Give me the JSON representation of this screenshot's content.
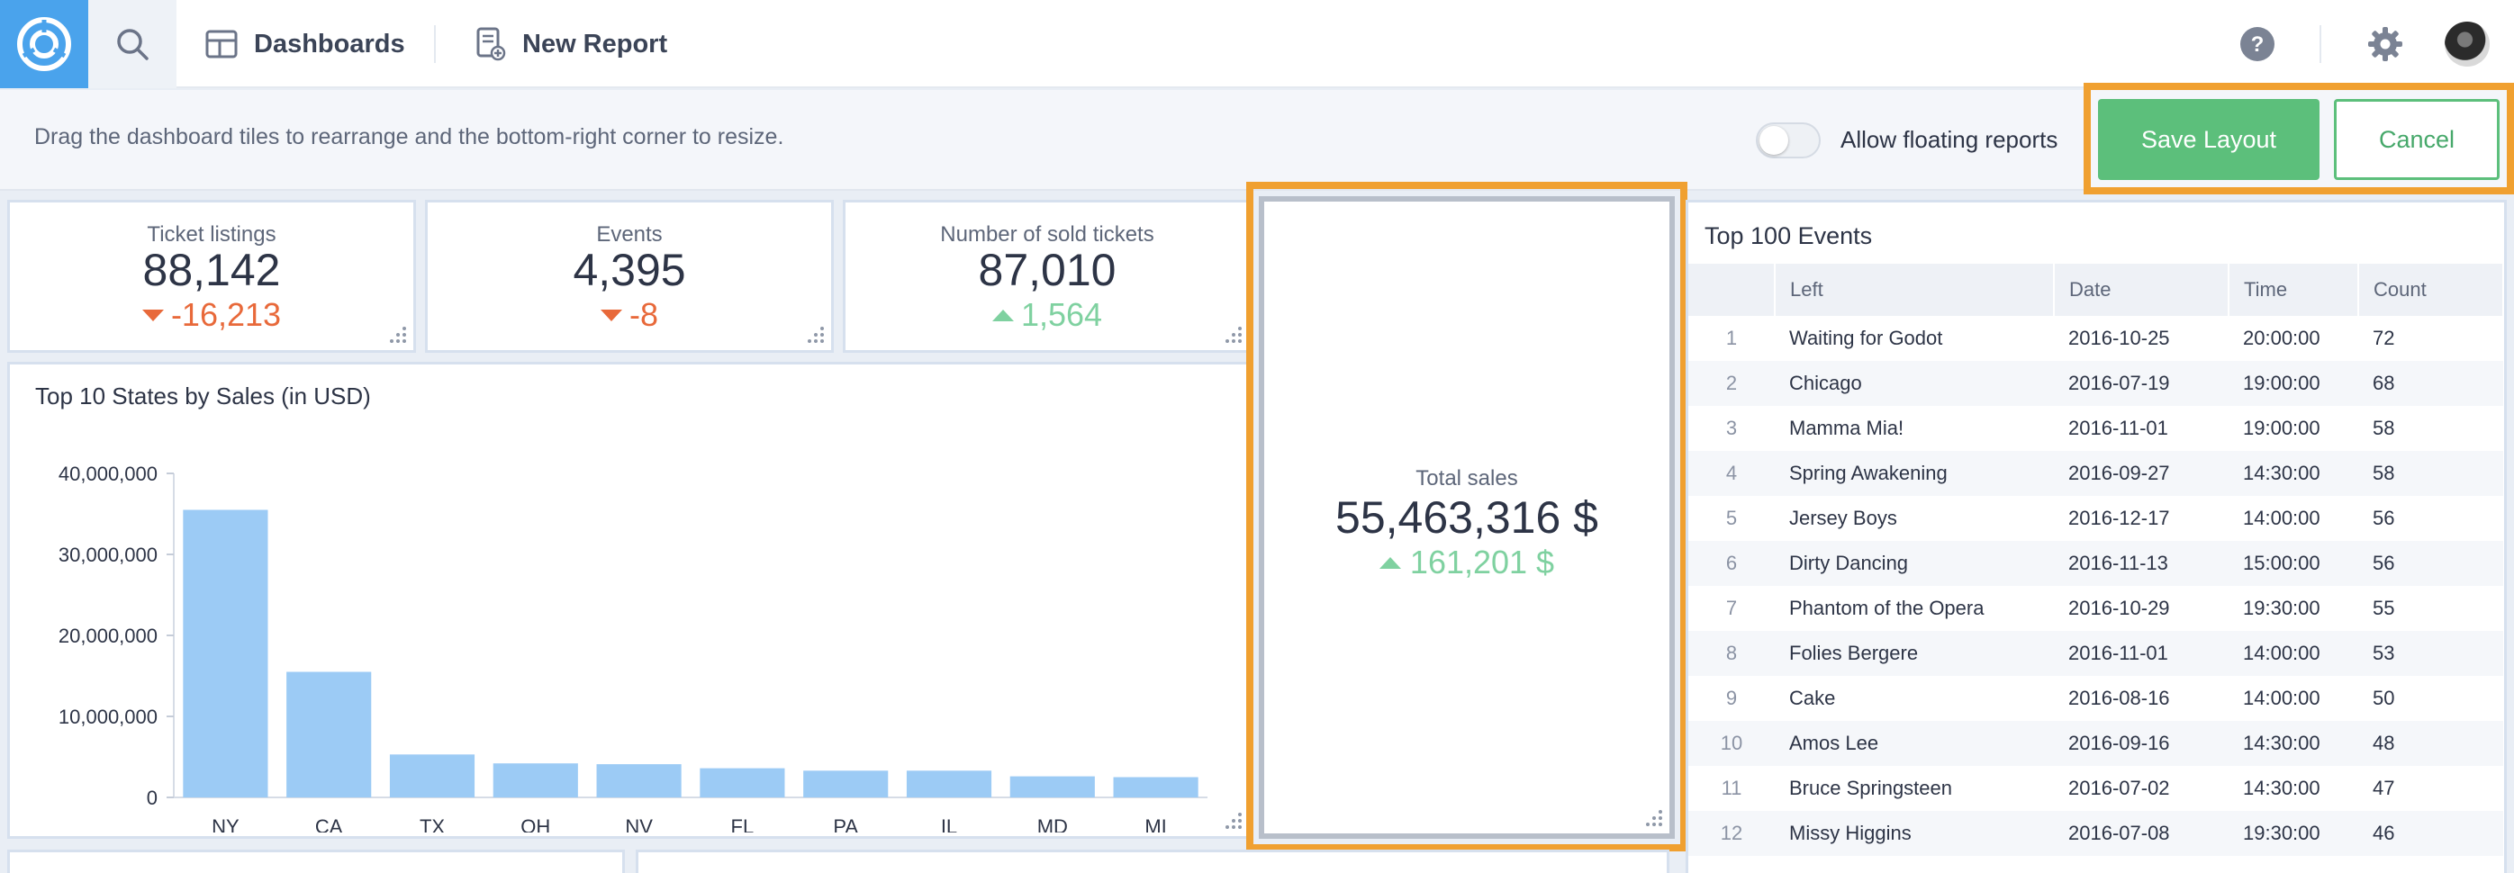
{
  "nav": {
    "dashboards_label": "Dashboards",
    "new_report_label": "New Report"
  },
  "editbar": {
    "hint": "Drag the dashboard tiles to rearrange and the bottom-right corner to resize.",
    "floating_label": "Allow floating reports",
    "floating_enabled": false,
    "save_label": "Save Layout",
    "cancel_label": "Cancel"
  },
  "kpis": [
    {
      "title": "Ticket listings",
      "value": "88,142",
      "delta": "-16,213",
      "direction": "down"
    },
    {
      "title": "Events",
      "value": "4,395",
      "delta": "-8",
      "direction": "down"
    },
    {
      "title": "Number of sold tickets",
      "value": "87,010",
      "delta": "1,564",
      "direction": "up"
    }
  ],
  "total_sales": {
    "title": "Total sales",
    "value": "55,463,316 $",
    "delta": "161,201 $",
    "direction": "up"
  },
  "chart_data": {
    "type": "bar",
    "title": "Top 10 States by Sales (in USD)",
    "categories": [
      "NY",
      "CA",
      "TX",
      "OH",
      "NV",
      "FL",
      "PA",
      "IL",
      "MD",
      "MI"
    ],
    "values": [
      35500000,
      15500000,
      5300000,
      4200000,
      4100000,
      3600000,
      3300000,
      3300000,
      2600000,
      2500000
    ],
    "yticks": [
      "0",
      "10,000,000",
      "20,000,000",
      "30,000,000",
      "40,000,000"
    ],
    "ylim": [
      0,
      40000000
    ],
    "color": "#9ccbf5"
  },
  "table": {
    "title": "Top 100 Events",
    "headers": [
      "",
      "Left",
      "Date",
      "Time",
      "Count"
    ],
    "rows": [
      [
        "1",
        "Waiting for Godot",
        "2016-10-25",
        "20:00:00",
        "72"
      ],
      [
        "2",
        "Chicago",
        "2016-07-19",
        "19:00:00",
        "68"
      ],
      [
        "3",
        "Mamma Mia!",
        "2016-11-01",
        "19:00:00",
        "58"
      ],
      [
        "4",
        "Spring Awakening",
        "2016-09-27",
        "14:30:00",
        "58"
      ],
      [
        "5",
        "Jersey Boys",
        "2016-12-17",
        "14:00:00",
        "56"
      ],
      [
        "6",
        "Dirty Dancing",
        "2016-11-13",
        "15:00:00",
        "56"
      ],
      [
        "7",
        "Phantom of the Opera",
        "2016-10-29",
        "19:30:00",
        "55"
      ],
      [
        "8",
        "Folies Bergere",
        "2016-11-01",
        "14:00:00",
        "53"
      ],
      [
        "9",
        "Cake",
        "2016-08-16",
        "14:00:00",
        "50"
      ],
      [
        "10",
        "Amos Lee",
        "2016-09-16",
        "14:30:00",
        "48"
      ],
      [
        "11",
        "Bruce Springsteen",
        "2016-07-02",
        "14:30:00",
        "47"
      ],
      [
        "12",
        "Missy Higgins",
        "2016-07-08",
        "19:30:00",
        "46"
      ]
    ]
  },
  "colors": {
    "accent": "#4aa3ec",
    "save": "#5cbf7b",
    "highlight": "#f0a030",
    "down": "#e8693a",
    "up": "#7fd1a0"
  }
}
